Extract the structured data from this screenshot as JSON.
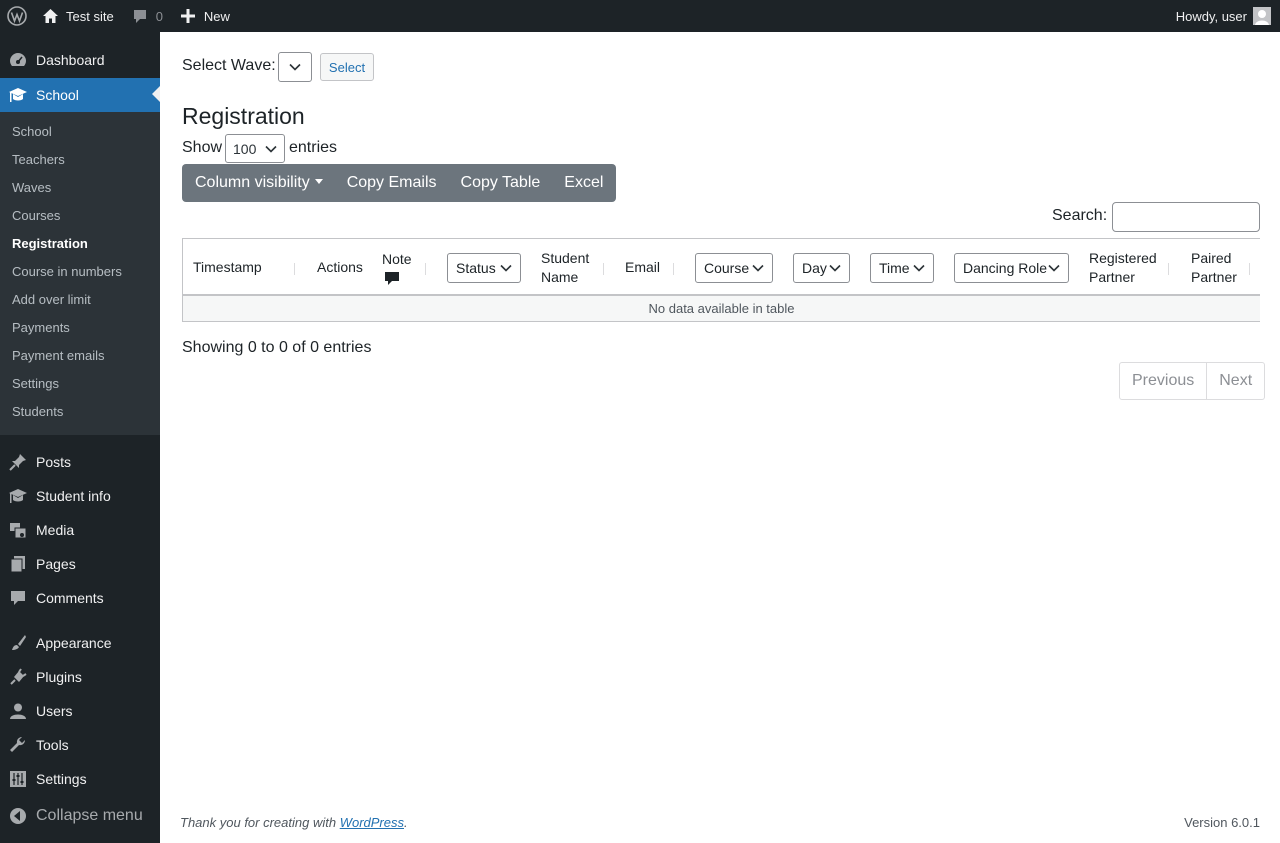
{
  "adminbar": {
    "site_name": "Test site",
    "comments_count": "0",
    "new_label": "New",
    "howdy": "Howdy, user"
  },
  "sidebar": {
    "top_items": [
      {
        "label": "Dashboard",
        "icon": "dashboard-icon"
      },
      {
        "label": "School",
        "icon": "school-icon"
      }
    ],
    "submenu": [
      "School",
      "Teachers",
      "Waves",
      "Courses",
      "Registration",
      "Course in numbers",
      "Add over limit",
      "Payments",
      "Payment emails",
      "Settings",
      "Students"
    ],
    "current_submenu": "Registration",
    "items": [
      {
        "label": "Posts",
        "icon": "pin-icon"
      },
      {
        "label": "Student info",
        "icon": "school-icon"
      },
      {
        "label": "Media",
        "icon": "media-icon"
      },
      {
        "label": "Pages",
        "icon": "pages-icon"
      },
      {
        "label": "Comments",
        "icon": "comment-icon"
      },
      {
        "label": "Appearance",
        "icon": "brush-icon"
      },
      {
        "label": "Plugins",
        "icon": "plugin-icon"
      },
      {
        "label": "Users",
        "icon": "user-icon"
      },
      {
        "label": "Tools",
        "icon": "wrench-icon"
      },
      {
        "label": "Settings",
        "icon": "settings-icon"
      }
    ],
    "collapse_label": "Collapse menu"
  },
  "main": {
    "select_wave_label": "Select Wave:",
    "select_wave_value": "",
    "select_button": "Select",
    "heading": "Registration",
    "show_label": "Show",
    "entries_value": "100",
    "entries_label": "entries",
    "buttons": [
      "Column visibility",
      "Copy Emails",
      "Copy Table",
      "Excel"
    ],
    "search_label": "Search:",
    "search_value": "",
    "columns": {
      "timestamp": "Timestamp",
      "actions": "Actions",
      "note": "Note",
      "status": "Status",
      "student_name_1": "Student",
      "student_name_2": "Name",
      "email": "Email",
      "course": "Course",
      "day": "Day",
      "time": "Time",
      "dancing_role": "Dancing Role",
      "registered_partner_1": "Registered",
      "registered_partner_2": "Partner",
      "paired_partner_1": "Paired",
      "paired_partner_2": "Partner"
    },
    "empty_text": "No data available in table",
    "info_text": "Showing 0 to 0 of 0 entries",
    "pagination": [
      "Previous",
      "Next"
    ]
  },
  "footer": {
    "thanks_prefix": "Thank you for creating with ",
    "thanks_link": "WordPress",
    "thanks_suffix": ".",
    "version": "Version 6.0.1"
  }
}
